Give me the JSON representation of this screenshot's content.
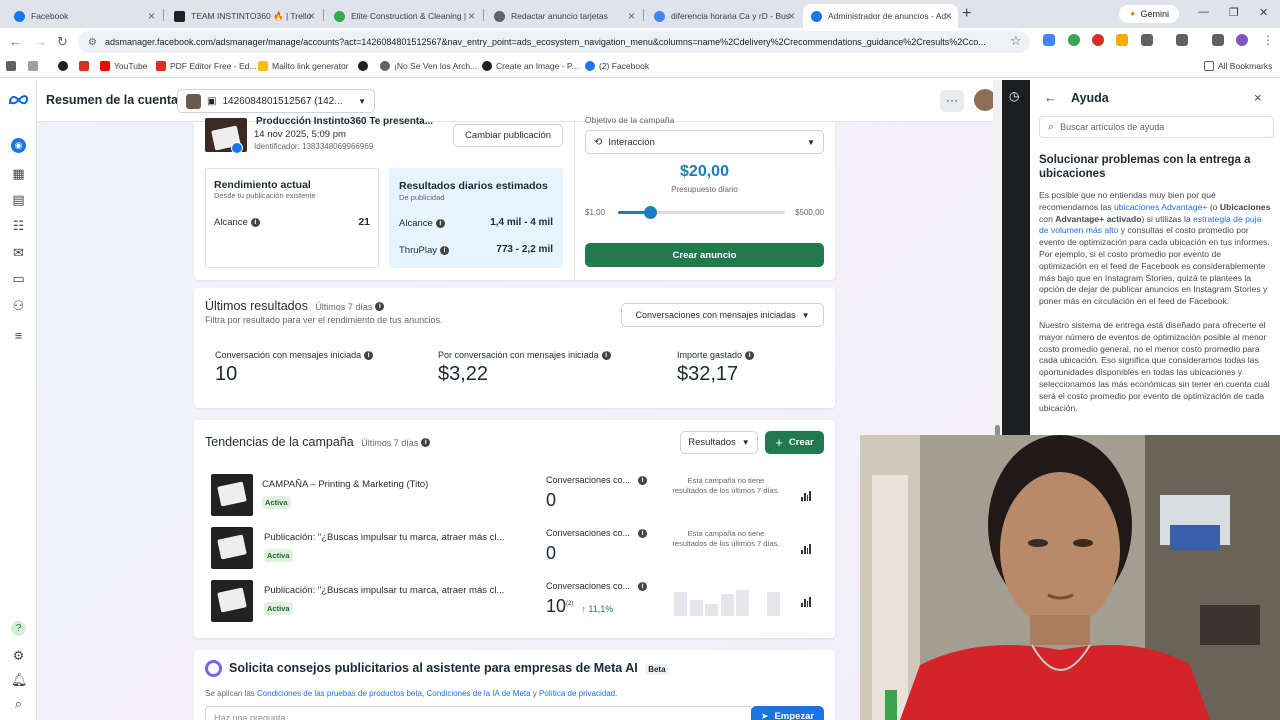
{
  "browser": {
    "tabs": [
      {
        "title": "Facebook",
        "icon_color": "#1877f2"
      },
      {
        "title": "TEAM INSTINTO360 🔥 | Trello",
        "icon_color": "#202124"
      },
      {
        "title": "Elite Construction & Cleaning |",
        "icon_color": "#34a853"
      },
      {
        "title": "Redactar anuncio tarjetas",
        "icon_color": "#5f6368"
      },
      {
        "title": "diferencia horaria Ca y rD - Bus",
        "icon_color": "#4285f4"
      },
      {
        "title": "Administrador de anuncios - Ad",
        "icon_color": "#1877f2"
      }
    ],
    "gemini_label": "Gemini",
    "url": "adsmanager.facebook.com/adsmanager/manage/accounts?act=1426084801512567&nav_entry_point=ads_ecosystem_navigation_menu&columns=name%2Cdelivery%2Crecommendations_guidance%2Cresults%2Cco...",
    "bookmarks": [
      {
        "label": "",
        "icon_color": "#202124"
      },
      {
        "label": "YouTube",
        "icon_color": "#ff0000"
      },
      {
        "label": "PDF Editor Free - Ed...",
        "icon_color": "#d93025"
      },
      {
        "label": "Mailto link generator",
        "icon_color": "#fbbc04"
      },
      {
        "label": "",
        "icon_color": "#202124"
      },
      {
        "label": "¡No Se Ven los Arch...",
        "icon_color": "#5f6368"
      },
      {
        "label": "Create an Image - P...",
        "icon_color": "#202124"
      },
      {
        "label": "(2) Facebook",
        "icon_color": "#1877f2"
      }
    ],
    "all_bookmarks": "All Bookmarks"
  },
  "header": {
    "title": "Resumen de la cuenta",
    "account": "1426084801512567 (142..."
  },
  "publication": {
    "title": "Producción Instinto360 Te presenta...",
    "date": "14 nov 2025, 5:09 pm",
    "id": "Identificador: 1383348069966969",
    "change_button": "Cambiar publicación",
    "actual_title": "Rendimiento actual",
    "actual_sub": "Desde tu publicación existente",
    "reach_label": "Alcance",
    "reach_value": "21",
    "est_title": "Resultados diarios estimados",
    "est_sub": "De publicidad",
    "est_reach_label": "Alcance",
    "est_reach_value": "1,4 mil - 4 mil",
    "thruplay_label": "ThruPlay",
    "thruplay_value": "773 - 2,2 mil",
    "objective_label": "Objetivo de la campaña",
    "objective_value": "Interacción",
    "budget": "$20,00",
    "budget_label": "Presupuesto diario",
    "slider_min": "$1,00",
    "slider_max": "$500,00",
    "slider_fraction": 0.19,
    "create_button": "Crear anuncio"
  },
  "results": {
    "title": "Últimos resultados",
    "period": "Últimos 7 días",
    "subtitle": "Filtra por resultado para ver el rendimiento de tus anuncios.",
    "filter": "Conversaciones con mensajes iniciadas",
    "metrics": [
      {
        "label": "Conversación con mensajes iniciada",
        "value": "10"
      },
      {
        "label": "Por conversación con mensajes iniciada",
        "value": "$3,22"
      },
      {
        "label": "Importe gastado",
        "value": "$32,17"
      }
    ]
  },
  "trends": {
    "title": "Tendencias de la campaña",
    "period": "Últimos 7 días",
    "results_dropdown": "Resultados",
    "create_button": "Crear",
    "rows": [
      {
        "name": "CAMPAÑA – Printing & Marketing (Tito)",
        "status": "Activa",
        "metric_label": "Conversaciones co...",
        "metric_value": "0",
        "note": "Esta campaña no tiene resultados de los últimos 7 días."
      },
      {
        "name": "Publicación: \"¿Buscas impulsar tu marca, atraer más cl...",
        "status": "Activa",
        "metric_label": "Conversaciones co...",
        "metric_value": "0",
        "note": "Esta campaña no tiene resultados de los últimos 7 días."
      },
      {
        "name": "Publicación: \"¿Buscas impulsar tu marca, atraer más cl...",
        "status": "Activa",
        "metric_label": "Conversaciones co...",
        "metric_value": "10",
        "superscript": "(2)",
        "change": "↑ 11,1%",
        "note": ""
      }
    ]
  },
  "ai": {
    "title": "Solicita consejos publicitarios al asistente para empresas de Meta AI",
    "beta": "Beta",
    "terms_prefix": "Se aplican las",
    "terms_link1": "Condiciones de las pruebas de productos beta",
    "terms_link2": "Condiciones de la IA de Meta",
    "terms_and": "y",
    "terms_link3": "Política de privacidad",
    "input_placeholder": "Haz una pregunta",
    "start_button": "Empezar"
  },
  "help": {
    "title": "Ayuda",
    "search_placeholder": "Buscar artículos de ayuda",
    "article_title": "Solucionar problemas con la entrega a ubicaciones",
    "p1_a": "Es posible que no entiendas muy bien por qué recomendamos las",
    "p1_link1": "ubicaciones Advantage+",
    "p1_b": "(o",
    "p1_bold1": "Ubicaciones",
    "p1_c": "con",
    "p1_bold2": "Advantage+ activado",
    "p1_d": ") si utilizas la",
    "p1_link2": "estrategia de puja de volumen más alto",
    "p1_e": "y consultas el costo promedio por evento de optimización para cada ubicación en tus informes. Por ejemplo, si el costo promedio por evento de optimización en el feed de Facebook es considerablemente más bajo que en Instagram Stories, quizá te plantees la opción de dejar de publicar anuncios en Instagram Stories y poner más en circulación en el feed de Facebook.",
    "p2": "Nuestro sistema de entrega está diseñado para ofrecerte el mayor número de eventos de optimización posible al menor costo promedio general, no el menor costo promedio para cada ubicación. Eso significa que consideramos todas las oportunidades disponibles en todas las ubicaciones y seleccionamos las más económicas sin tener en cuenta cuál será el costo promedio por evento de optimización de cada ubicación."
  },
  "colors": {
    "accent_green": "#217a4e",
    "link_blue": "#216fdb",
    "budget_blue": "#1a7fbf"
  }
}
